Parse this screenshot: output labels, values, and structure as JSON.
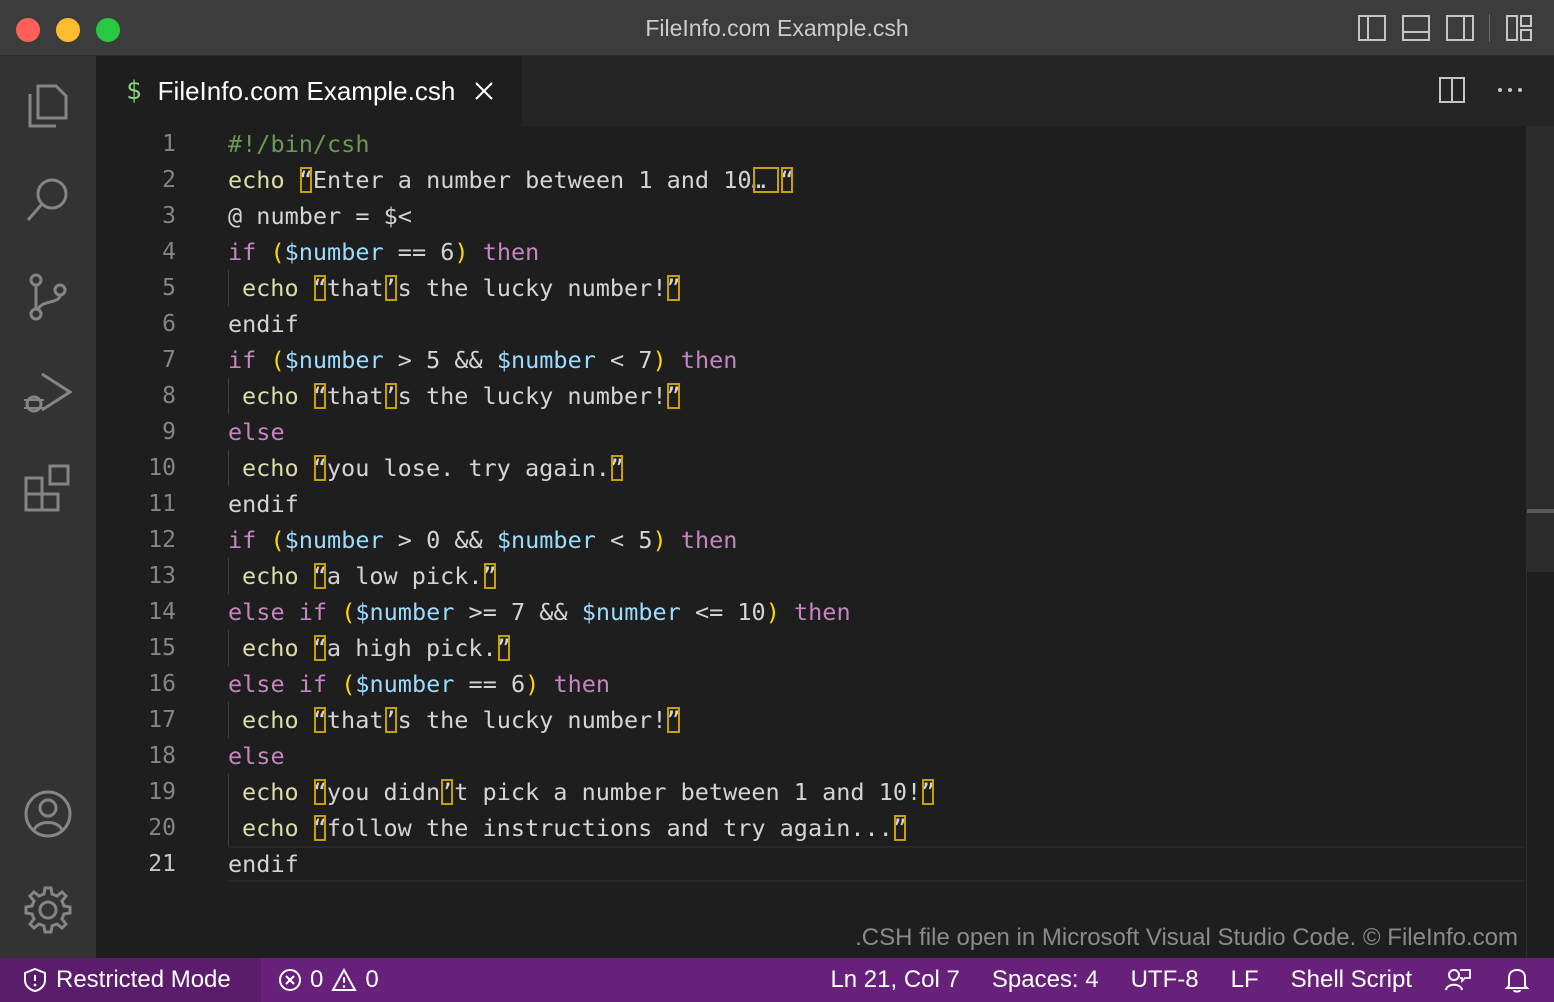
{
  "window": {
    "title": "FileInfo.com Example.csh"
  },
  "tab": {
    "label": "FileInfo.com Example.csh",
    "icon": "$"
  },
  "line_numbers": [
    "1",
    "2",
    "3",
    "4",
    "5",
    "6",
    "7",
    "8",
    "9",
    "10",
    "11",
    "12",
    "13",
    "14",
    "15",
    "16",
    "17",
    "18",
    "19",
    "20",
    "21"
  ],
  "code": {
    "l1": "#!/bin/csh",
    "l2a": "echo",
    "l2b": "Enter a number between 1 and 10",
    "l2c": "… ",
    "l3": "@ number = $<",
    "l4a": "if",
    "l4b": "$number",
    "l4c": " == 6",
    "l4d": "then",
    "echo": "echo",
    "that": "that",
    "lucky": "s the lucky number!",
    "l6": "endif",
    "l7c": " > 5 && ",
    "l7e": " < 7",
    "l9": "else",
    "l10": "you lose. try again.",
    "l11": "endif",
    "l12c": " > 0 && ",
    "l12e": " < 5",
    "l13": "a low pick.",
    "l14a": "else if",
    "l14c": " >= 7 && ",
    "l14e": " <= 10",
    "l15": "a high pick.",
    "l16c": " == 6",
    "l18": "else",
    "l19a": "you didn",
    "l19b": "t pick a number between 1 and 10!",
    "l20": "follow the instructions and try again...",
    "l21": "endif"
  },
  "watermark": ".CSH file open in Microsoft Visual Studio Code. © FileInfo.com",
  "status": {
    "restricted": "Restricted Mode",
    "errors": "0",
    "warnings": "0",
    "position": "Ln 21, Col 7",
    "spaces": "Spaces: 4",
    "encoding": "UTF-8",
    "eol": "LF",
    "language": "Shell Script"
  },
  "colors": {
    "status_bar": "#68217a",
    "restricted_bg": "#5c1c6c",
    "keyword": "#c586c0",
    "variable": "#9cdcfe",
    "builtin": "#dcdcaa",
    "comment": "#6a9955"
  }
}
